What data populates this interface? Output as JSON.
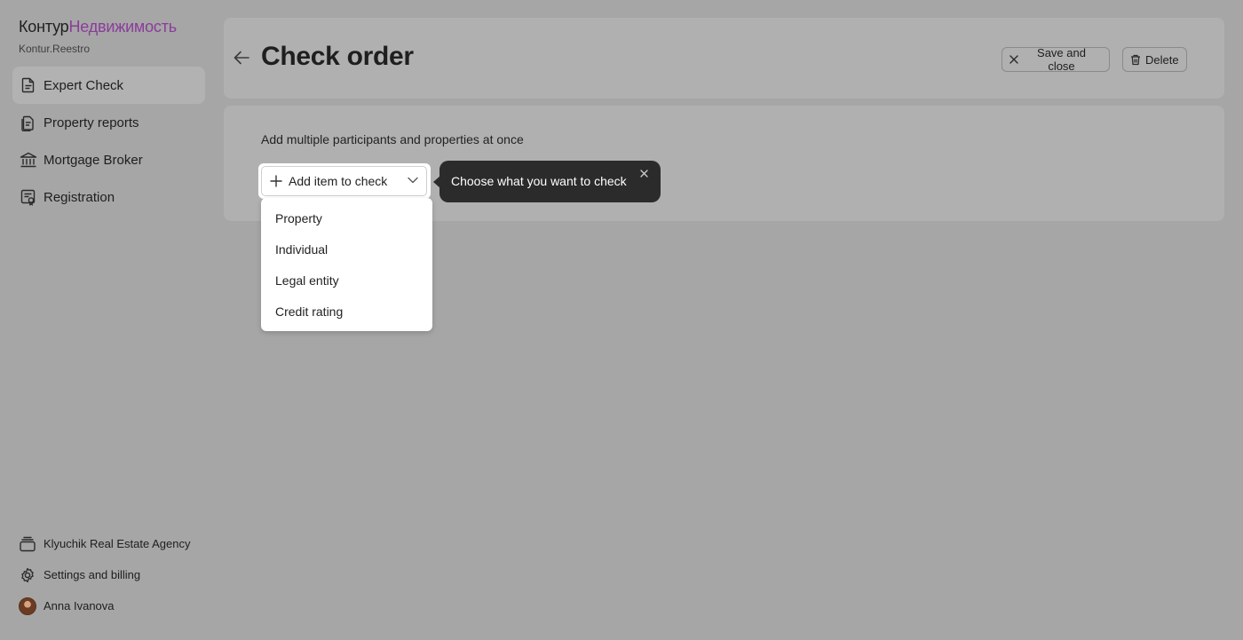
{
  "sidebar": {
    "brand_primary": "Контур",
    "brand_secondary": "Недвижимость",
    "brand_subtitle": "Kontur.Reestro",
    "items": [
      {
        "label": "Expert Check",
        "icon": "document-icon",
        "active": true
      },
      {
        "label": "Property reports",
        "icon": "report-icon",
        "active": false
      },
      {
        "label": "Mortgage Broker",
        "icon": "bank-icon",
        "active": false
      },
      {
        "label": "Registration",
        "icon": "certificate-icon",
        "active": false
      }
    ],
    "footer": {
      "organization": "Klyuchik Real Estate Agency",
      "settings": "Settings and billing",
      "user": "Anna Ivanova"
    }
  },
  "header": {
    "title": "Check order",
    "save_close_label": "Save and close",
    "delete_label": "Delete"
  },
  "content": {
    "hint": "Add multiple participants and properties at once",
    "add_button_label": "Add item to check",
    "tooltip": "Choose what you want to check",
    "menu_items": [
      "Property",
      "Individual",
      "Legal entity",
      "Credit rating"
    ]
  },
  "colors": {
    "brand_accent": "#8a3d9a",
    "overlay_background": "#a6a6a6",
    "tooltip_background": "#2b2b2b"
  }
}
